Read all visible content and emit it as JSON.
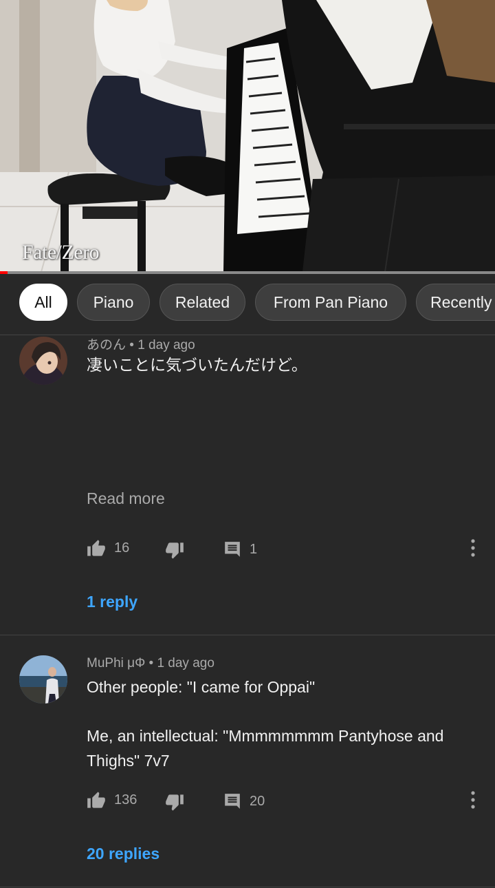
{
  "video": {
    "caption": "Fate/Zero",
    "progress_fraction": 0.015
  },
  "chips": [
    {
      "label": "All",
      "active": true
    },
    {
      "label": "Piano",
      "active": false
    },
    {
      "label": "Related",
      "active": false
    },
    {
      "label": "From Pan Piano",
      "active": false
    },
    {
      "label": "Recently uploaded",
      "active": false
    }
  ],
  "comments": [
    {
      "author": "あのん",
      "time": "1 day ago",
      "meta": "あのん • 1 day ago",
      "text": "凄いことに気づいたんだけど。",
      "read_more": "Read more",
      "likes": "16",
      "reply_count": "1",
      "replies_link": "1 reply"
    },
    {
      "author": "MuPhi μΦ",
      "time": "1 day ago",
      "meta": "MuPhi μΦ • 1 day ago",
      "text_line1": "Other people: \"I came for Oppai\"",
      "text_line2": "Me, an intellectual: \"Mmmmmmmm Pantyhose and Thighs\" 7v7",
      "likes": "136",
      "reply_count": "20",
      "replies_link": "20 replies"
    }
  ],
  "icons": {
    "like": "thumbs-up-icon",
    "dislike": "thumbs-down-icon",
    "reply": "comment-icon",
    "more": "more-vert-icon"
  },
  "colors": {
    "background": "#282828",
    "link": "#3ea6ff",
    "progress": "#ff0000"
  }
}
